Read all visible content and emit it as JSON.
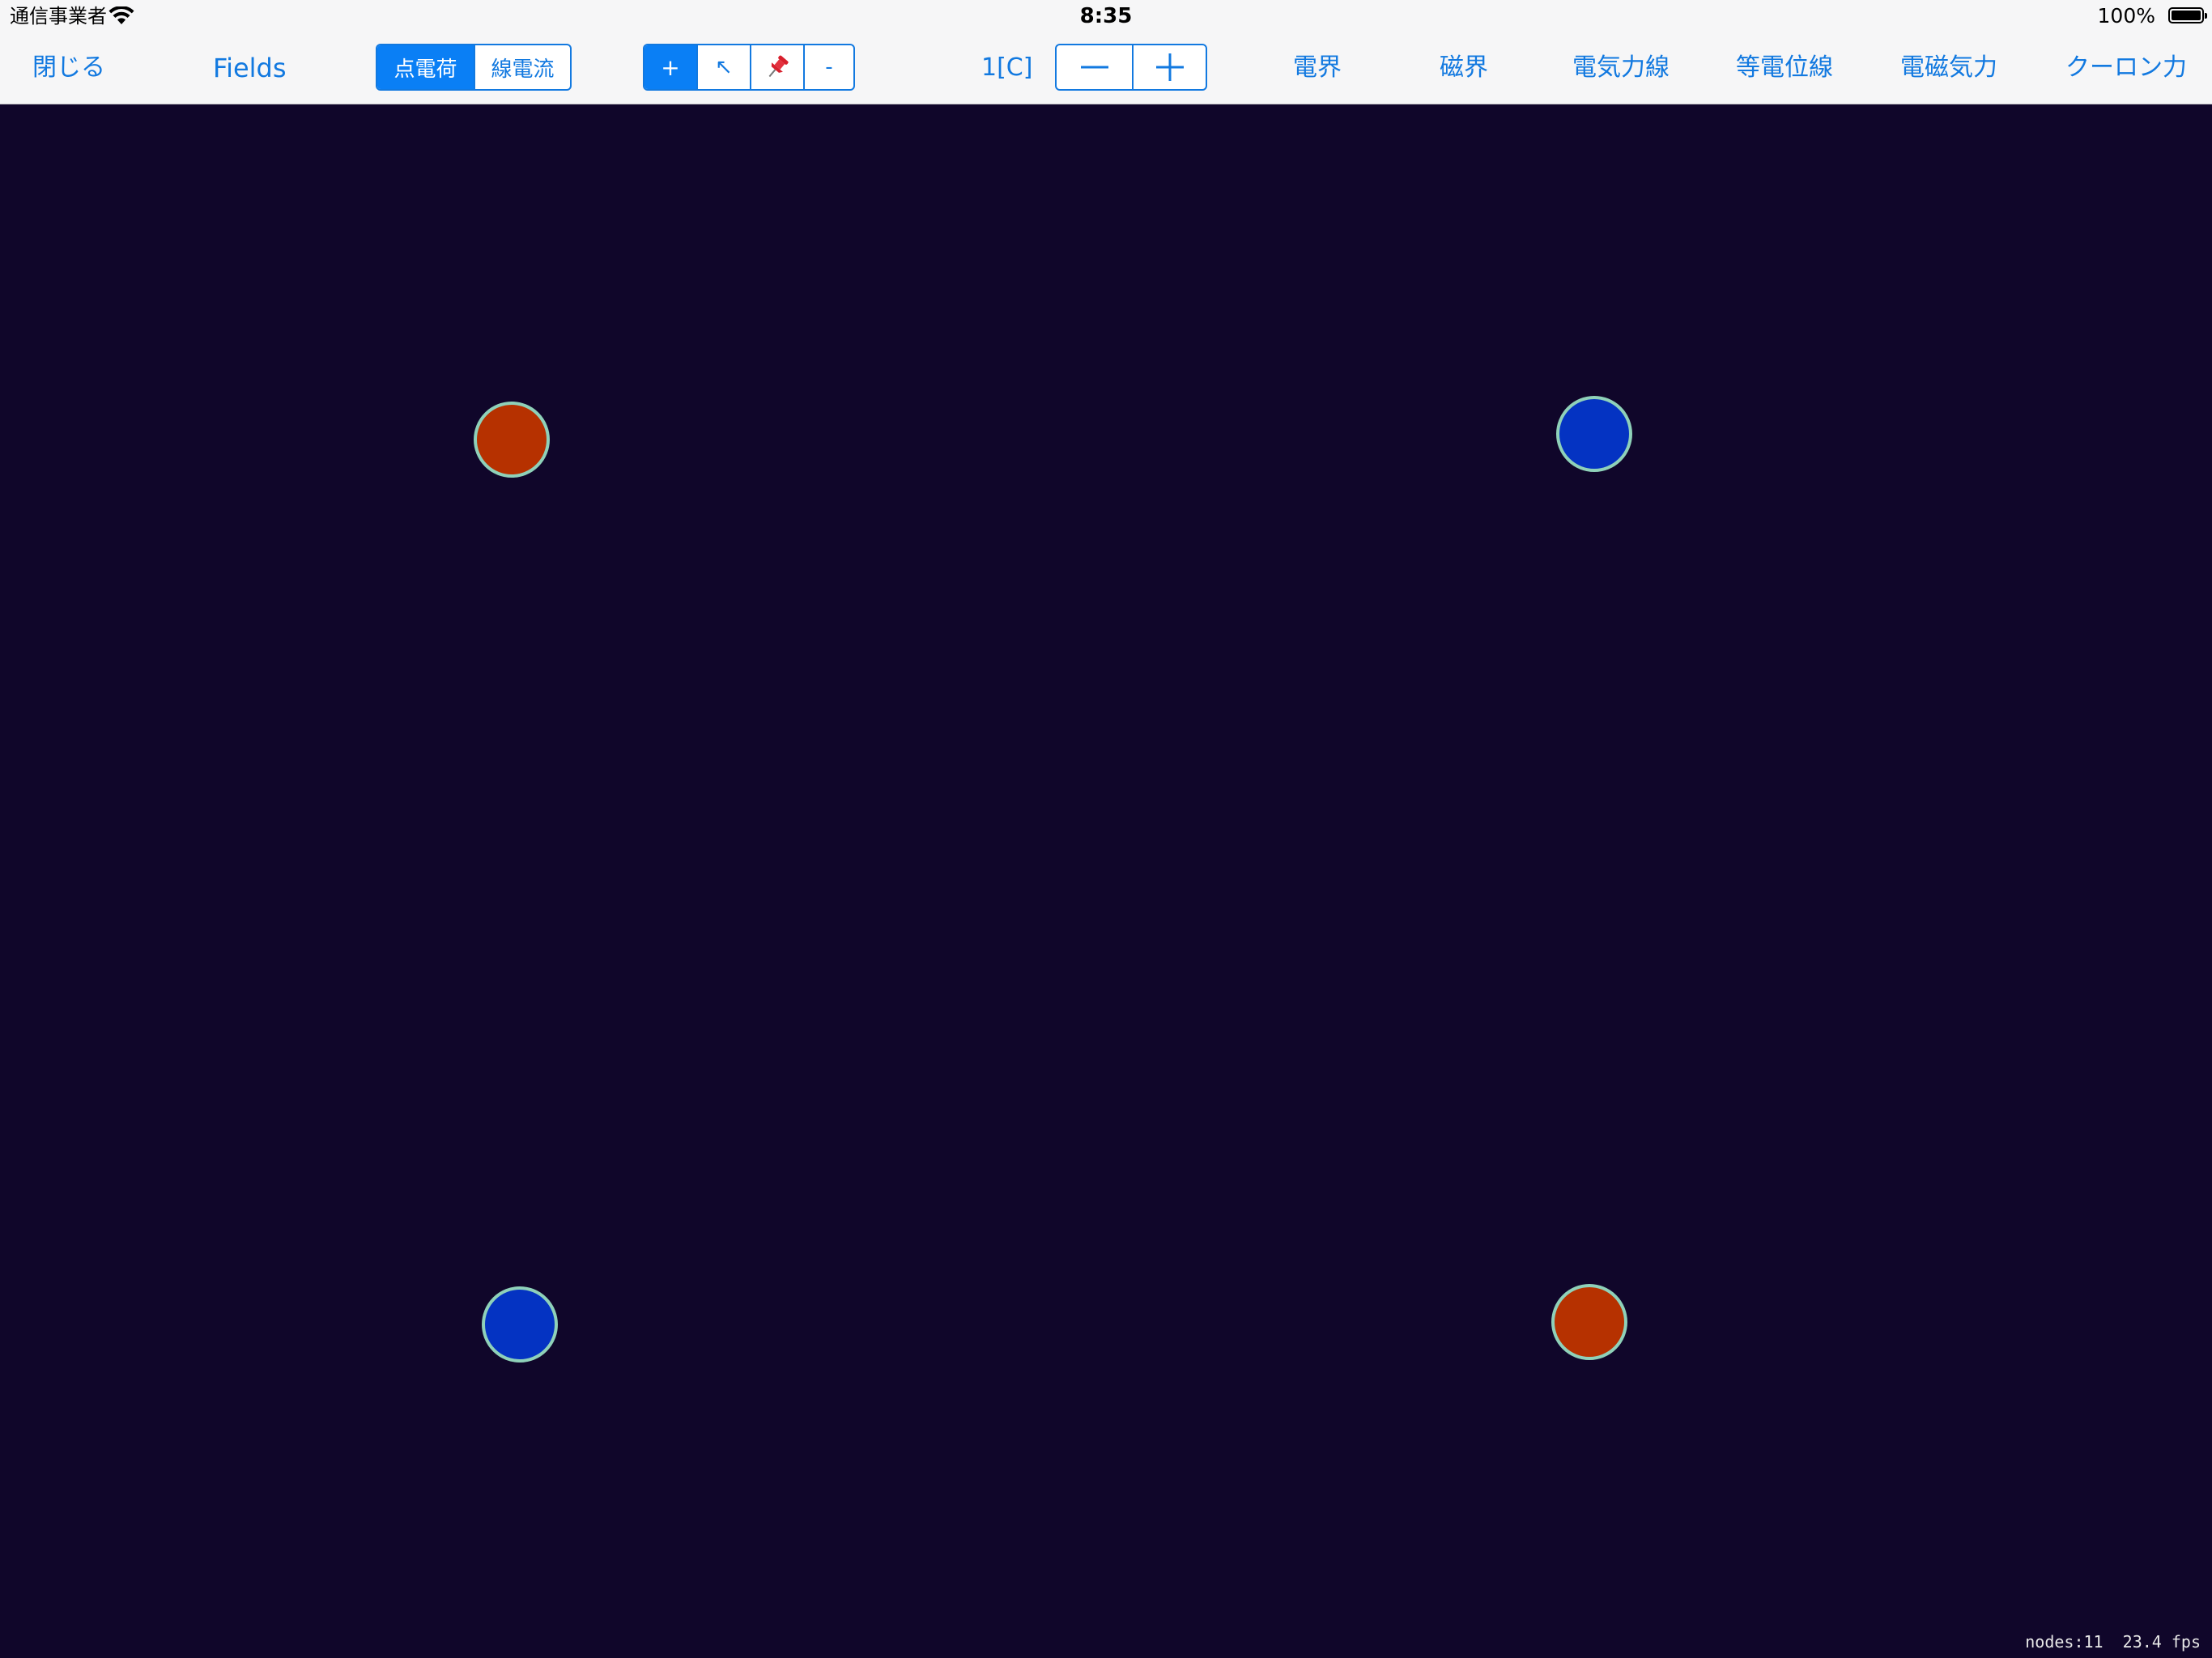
{
  "status_bar": {
    "carrier": "通信事業者",
    "time": "8:35",
    "battery": "100%"
  },
  "toolbar": {
    "close_label": "閉じる",
    "title": "Fields",
    "source_type": {
      "options": [
        "点電荷",
        "線電流"
      ],
      "selected": "点電荷"
    },
    "tools": {
      "add": "+",
      "select": "↖",
      "pin_icon": "pushpin-icon",
      "remove": "-"
    },
    "charge_value": "1[C]",
    "decrease": "—",
    "increase": "+",
    "display_toggles": [
      "電界",
      "磁界",
      "電気力線",
      "等電位線",
      "電磁気力",
      "クーロン力"
    ]
  },
  "colors": {
    "canvas_bg": "#10062a",
    "positive_charge": "#b63100",
    "negative_charge": "#0433c2",
    "charge_outline": "#8fd1b9",
    "accent": "#1279e0"
  },
  "charges": [
    {
      "sign": "positive"
    },
    {
      "sign": "negative"
    },
    {
      "sign": "negative"
    },
    {
      "sign": "positive"
    }
  ],
  "stats": {
    "nodes": "nodes:11",
    "fps": "23.4 fps"
  }
}
